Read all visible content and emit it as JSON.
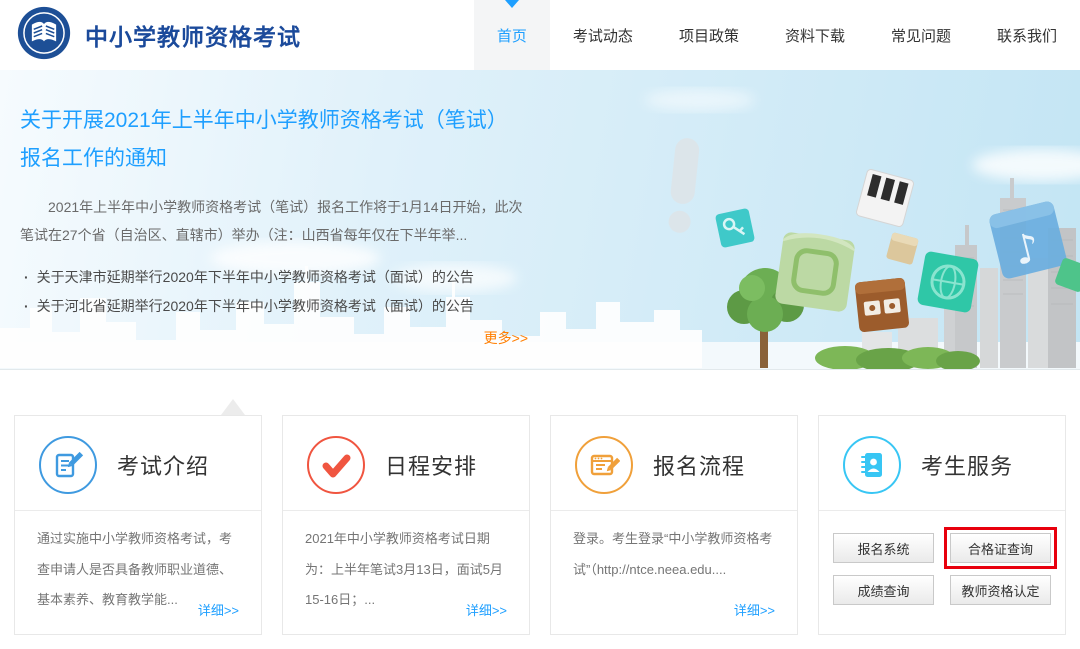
{
  "header": {
    "site_title": "中小学教师资格考试",
    "nav": [
      {
        "label": "首页",
        "active": true
      },
      {
        "label": "考试动态",
        "active": false
      },
      {
        "label": "项目政策",
        "active": false
      },
      {
        "label": "资料下载",
        "active": false
      },
      {
        "label": "常见问题",
        "active": false
      },
      {
        "label": "联系我们",
        "active": false
      }
    ]
  },
  "banner": {
    "title": "关于开展2021年上半年中小学教师资格考试（笔试）报名工作的通知",
    "summary": "2021年上半年中小学教师资格考试（笔试）报名工作将于1月14日开始，此次笔试在27个省（自治区、直辖市）举办（注：山西省每年仅在下半年举...",
    "news": [
      "关于天津市延期举行2020年下半年中小学教师资格考试（面试）的公告",
      "关于河北省延期举行2020年下半年中小学教师资格考试（面试）的公告"
    ],
    "more_label": "更多>>"
  },
  "cards": [
    {
      "title": "考试介绍",
      "icon": "exam-intro-icon",
      "accent": "#3f9ae0",
      "text": "通过实施中小学教师资格考试，考查申请人是否具备教师职业道德、基本素养、教育教学能...",
      "link_label": "详细>>"
    },
    {
      "title": "日程安排",
      "icon": "schedule-check-icon",
      "accent": "#f05540",
      "text": "2021年中小学教师资格考试日期为：上半年笔试3月13日，面试5月15-16日；...",
      "link_label": "详细>>"
    },
    {
      "title": "报名流程",
      "icon": "signup-flow-icon",
      "accent": "#f0a03a",
      "text": "登录。考生登录“中小学教师资格考试”（http://ntce.neea.edu....",
      "link_label": "详细>>"
    },
    {
      "title": "考生服务",
      "icon": "candidate-service-icon",
      "accent": "#38c6f4",
      "buttons": [
        "报名系统",
        "合格证查询",
        "成绩查询",
        "教师资格认定"
      ],
      "highlighted_button": "合格证查询"
    }
  ],
  "colors": {
    "primary_blue": "#1e9fff",
    "dark_blue": "#1b4a9b",
    "orange_link": "#ff7e00",
    "highlight_red": "#e8000d"
  }
}
